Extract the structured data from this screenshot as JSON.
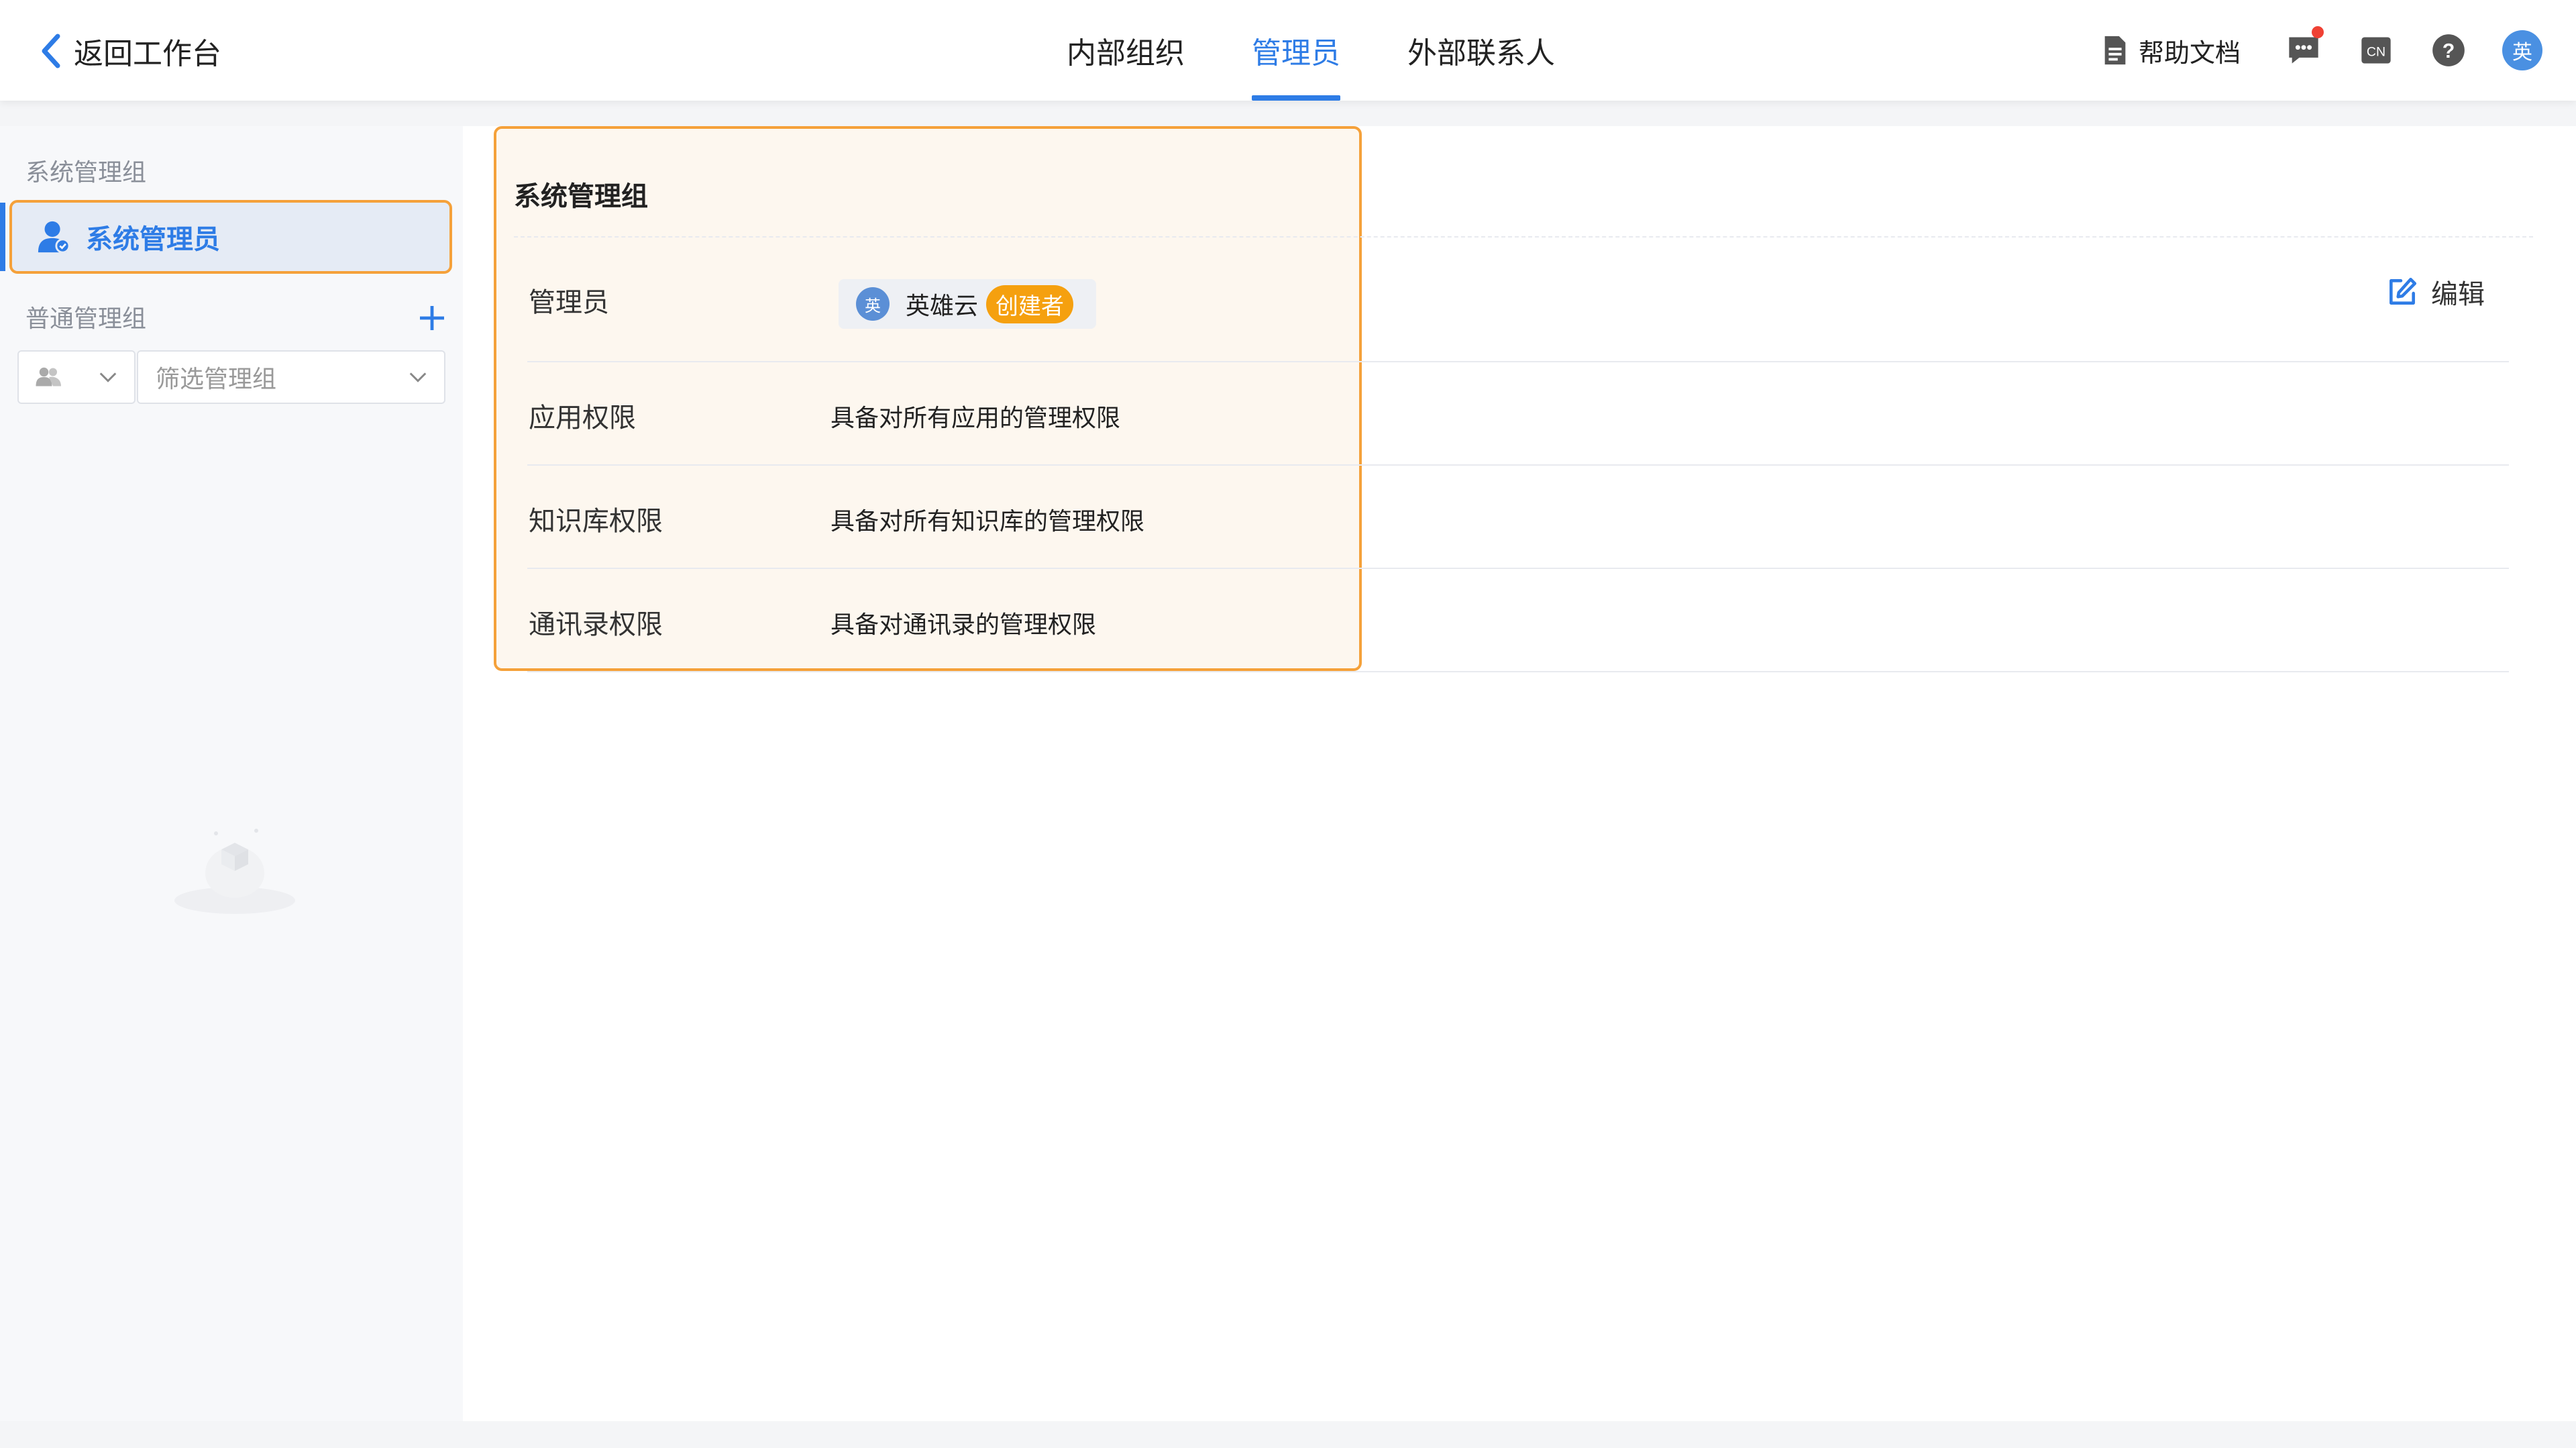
{
  "header": {
    "back_label": "返回工作台",
    "tabs": [
      {
        "label": "内部组织",
        "active": false
      },
      {
        "label": "管理员",
        "active": true
      },
      {
        "label": "外部联系人",
        "active": false
      }
    ],
    "help_docs_label": "帮助文档",
    "language_icon_text": "CN",
    "user_avatar_text": "英"
  },
  "sidebar": {
    "system_section_title": "系统管理组",
    "selected_item_label": "系统管理员",
    "normal_section_title": "普通管理组",
    "filter_placeholder": "筛选管理组"
  },
  "main": {
    "group_title": "系统管理组",
    "edit_label": "编辑",
    "rows": [
      {
        "label": "管理员"
      },
      {
        "label": "应用权限",
        "value": "具备对所有应用的管理权限"
      },
      {
        "label": "知识库权限",
        "value": "具备对所有知识库的管理权限"
      },
      {
        "label": "通讯录权限",
        "value": "具备对通讯录的管理权限"
      }
    ],
    "admin": {
      "avatar_text": "英",
      "name": "英雄云",
      "badge": "创建者"
    }
  },
  "colors": {
    "accent": "#2e7ce6",
    "highlight_border": "#f5a13a",
    "badge": "#f5a00f",
    "notification_dot": "#f04134"
  }
}
